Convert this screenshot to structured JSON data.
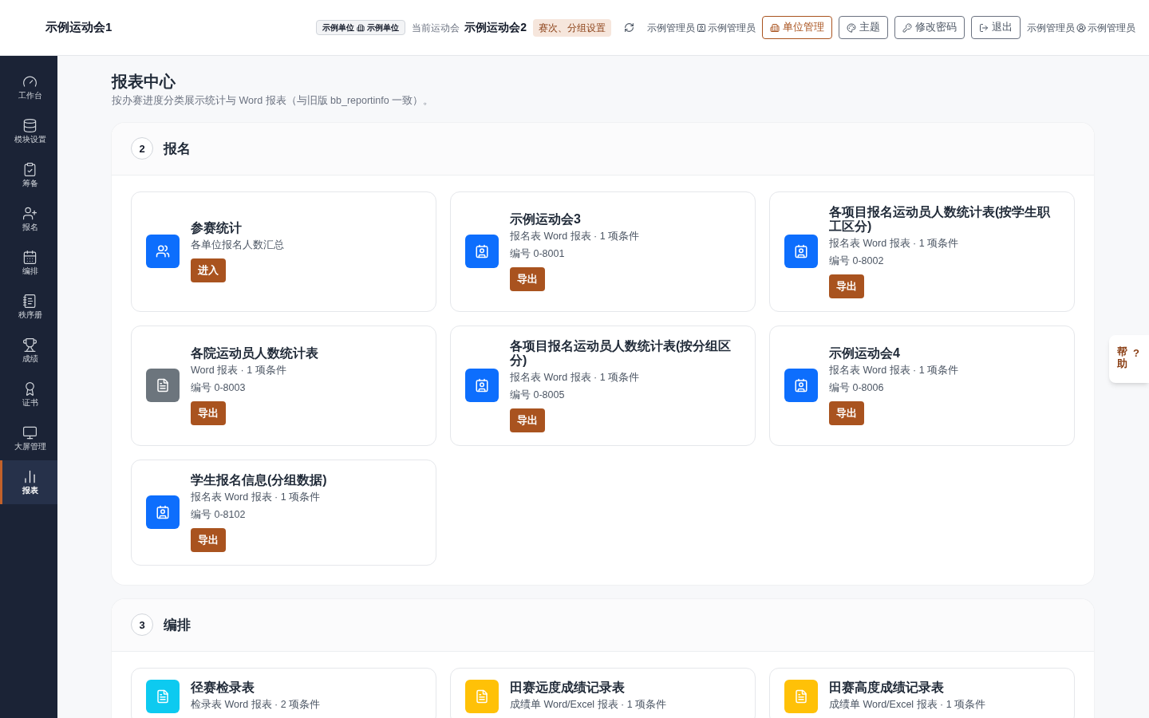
{
  "header": {
    "app_title": "示例运动会1",
    "unit_badge": {
      "left": "示例单位",
      "right": "示例单位"
    },
    "current_label": "当前运动会",
    "current_meet": "示例运动会2",
    "settings_badge": "赛次、分组设置",
    "user_a": {
      "left": "示例管理员",
      "right": "示例管理员"
    },
    "buttons": [
      {
        "label": "单位管理",
        "kind": "unit",
        "selected": true
      },
      {
        "label": "主题",
        "kind": "theme",
        "selected": false
      },
      {
        "label": "修改密码",
        "kind": "password",
        "selected": false
      },
      {
        "label": "退出",
        "kind": "logout",
        "selected": false
      }
    ],
    "user_b": {
      "left": "示例管理员",
      "right": "示例管理员"
    }
  },
  "sidebar": {
    "items": [
      {
        "label": "工作台",
        "kind": "dashboard",
        "selected": false
      },
      {
        "label": "模块设置",
        "kind": "modules",
        "selected": false
      },
      {
        "label": "筹备",
        "kind": "prepare",
        "selected": false
      },
      {
        "label": "报名",
        "kind": "signup",
        "selected": false
      },
      {
        "label": "编排",
        "kind": "schedule",
        "selected": false
      },
      {
        "label": "秩序册",
        "kind": "booklet",
        "selected": false
      },
      {
        "label": "成绩",
        "kind": "results",
        "selected": false
      },
      {
        "label": "证书",
        "kind": "certificate",
        "selected": false
      },
      {
        "label": "大屏管理",
        "kind": "screen",
        "selected": false
      },
      {
        "label": "报表",
        "kind": "reports",
        "selected": true
      }
    ]
  },
  "page": {
    "title": "报表中心",
    "subtitle": "按办赛进度分类展示统计与 Word 报表（与旧版 bb_reportinfo 一致）。"
  },
  "sections": [
    {
      "number": "2",
      "title": "报名",
      "cards": [
        {
          "title": "参赛统计",
          "subtitle": "各单位报名人数汇总",
          "button": "进入",
          "kind": "group",
          "color": "#0d6efd"
        },
        {
          "title": "示例运动会3",
          "subtitle": "报名表 Word 报表 · 1 项条件",
          "code": "编号 0-8001",
          "button": "导出",
          "kind": "contact",
          "color": "#0d6efd"
        },
        {
          "title": "各项目报名运动员人数统计表(按学生职工区分)",
          "subtitle": "报名表 Word 报表 · 1 项条件",
          "code": "编号 0-8002",
          "button": "导出",
          "kind": "contact",
          "color": "#0d6efd"
        },
        {
          "title": "各院运动员人数统计表",
          "subtitle": "Word 报表 · 1 项条件",
          "code": "编号 0-8003",
          "button": "导出",
          "kind": "file",
          "color": "#6c757d"
        },
        {
          "title": "各项目报名运动员人数统计表(按分组区分)",
          "subtitle": "报名表 Word 报表 · 1 项条件",
          "code": "编号 0-8005",
          "button": "导出",
          "kind": "contact",
          "color": "#0d6efd"
        },
        {
          "title": "示例运动会4",
          "subtitle": "报名表 Word 报表 · 1 项条件",
          "code": "编号 0-8006",
          "button": "导出",
          "kind": "contact",
          "color": "#0d6efd"
        },
        {
          "title": "学生报名信息(分组数据)",
          "subtitle": "报名表 Word 报表 · 1 项条件",
          "code": "编号 0-8102",
          "button": "导出",
          "kind": "contact",
          "color": "#0d6efd"
        }
      ]
    },
    {
      "number": "3",
      "title": "编排",
      "cards": [
        {
          "title": "径赛检录表",
          "subtitle": "检录表 Word 报表 · 2 项条件",
          "kind": "file",
          "color": "#0dcaf0"
        },
        {
          "title": "田赛远度成绩记录表",
          "subtitle": "成绩单 Word/Excel 报表 · 1 项条件",
          "kind": "file",
          "color": "#ffc107"
        },
        {
          "title": "田赛高度成绩记录表",
          "subtitle": "成绩单 Word/Excel 报表 · 1 项条件",
          "kind": "file",
          "color": "#ffc107"
        }
      ]
    }
  ],
  "help": {
    "label": "帮助",
    "mark": "?"
  }
}
